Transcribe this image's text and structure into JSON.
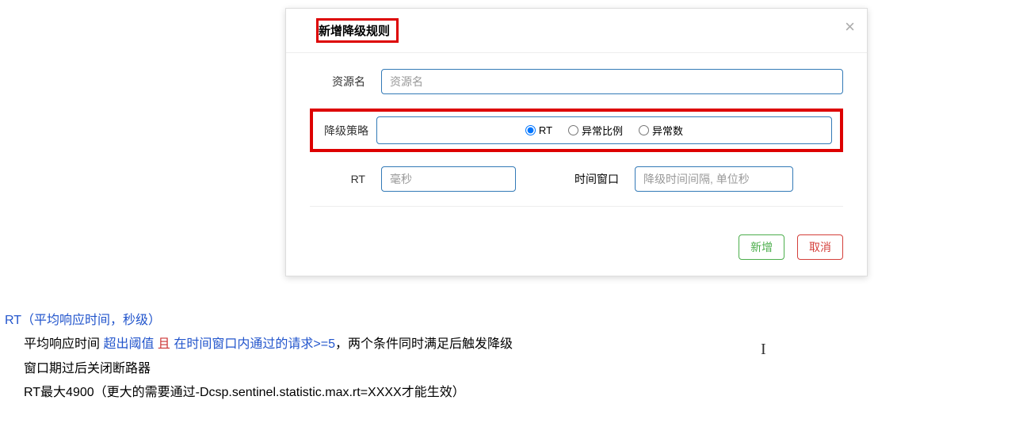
{
  "modal": {
    "title": "新增降级规则",
    "close": "×",
    "resource": {
      "label": "资源名",
      "placeholder": "资源名"
    },
    "strategy": {
      "label": "降级策略",
      "options": {
        "rt": "RT",
        "ratio": "异常比例",
        "count": "异常数"
      }
    },
    "rt": {
      "label": "RT",
      "placeholder": "毫秒"
    },
    "window": {
      "label": "时间窗口",
      "placeholder": "降级时间间隔, 单位秒"
    },
    "buttons": {
      "add": "新增",
      "cancel": "取消"
    }
  },
  "notes": {
    "line1_a": "RT（平均响应时间，秒级）",
    "line2_a": "平均响应时间   ",
    "line2_b": "超出阈值",
    "line2_c": " 且   ",
    "line2_d": "在时间窗口内通过的请求>=5",
    "line2_e": "，两个条件同时满足后触发降级",
    "line3": "窗口期过后关闭断路器",
    "line4": "RT最大4900（更大的需要通过-Dcsp.sentinel.statistic.max.rt=XXXX才能生效）"
  }
}
